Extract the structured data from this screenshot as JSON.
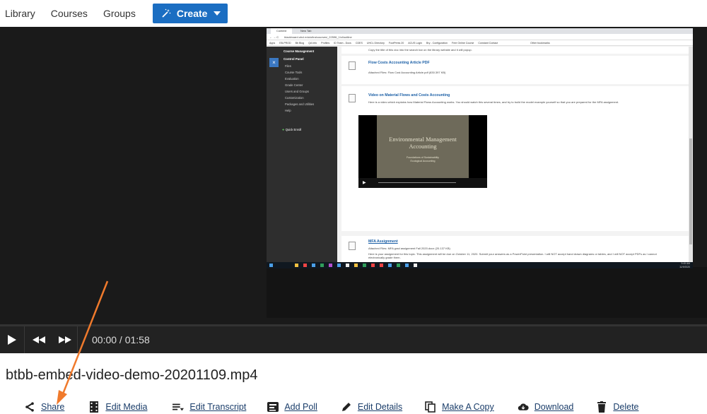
{
  "topnav": {
    "links": [
      "Library",
      "Courses",
      "Groups"
    ],
    "create_label": "Create"
  },
  "recording": {
    "tabs": [
      "Content",
      "New Tab"
    ],
    "address": "blackboard.uhcl.edu/ultra/courses/_22596_1/cl/outline",
    "bookmarks": [
      "Apps",
      "EB-PROD",
      "Bb Blog",
      "QA Info",
      "Profiles",
      "ID Team - Docs",
      "CDES",
      "UHCL Directory",
      "FootPrints 20",
      "ACUS Login",
      "Bry - Configuration",
      "Free Online Course",
      "Constant Contact",
      "Other bookmarks"
    ],
    "control_panel": {
      "course_management": "Course Management",
      "title": "Control Panel",
      "items": [
        "Files",
        "Course Tools",
        "Evaluation",
        "Grade Center",
        "Users and Groups",
        "Customization",
        "Packages and Utilities",
        "Help"
      ],
      "quick_enroll": "Quick Enroll"
    },
    "top_text": "Copy the title of this doc into the search bar on the library website and it will popup.",
    "item1_title": "Flow Costs Accounting Article PDF",
    "item1_attached": "Attached Files:  Flow Cost Accounting Article.pdf  (830.397 KB)",
    "item2_title": "Video on Material Flows and Costs Accounting",
    "item2_text": "Here is a video which explains how Material Flows Accounting works. You should watch this several times, and try to build the model example yourself so that you are prepared for the MFA assignment.",
    "slide_title": "Environmental Management Accounting",
    "slide_sub": "Foundations of Sustainability\nEcological Accounting",
    "item3_title": "MFA Assignment",
    "item3_attached": "Attached Files:  MFA grad assignment Fall 2020.docx  (20.137 KB)",
    "item3_text": "Here is your assignment for this topic. This assignment will be due on October 11, 2020. Submit your answers as a PowerPoint presentation. I will NOT accept hand drawn diagrams or tables, and I will NOT accept PDFs as I cannot electronically grade them.",
    "clock_time": "9:45 AM",
    "clock_date": "11/9/2020"
  },
  "player": {
    "timecode": "00:00 / 01:58"
  },
  "media_title": "btbb-embed-video-demo-20201109.mp4",
  "actions": [
    {
      "label": "Share",
      "icon": "share-icon"
    },
    {
      "label": "Edit Media",
      "icon": "film-icon"
    },
    {
      "label": "Edit Transcript",
      "icon": "transcript-icon"
    },
    {
      "label": "Add Poll",
      "icon": "poll-icon"
    },
    {
      "label": "Edit Details",
      "icon": "pencil-icon"
    },
    {
      "label": "Make A Copy",
      "icon": "copy-icon"
    },
    {
      "label": "Download",
      "icon": "cloud-download-icon"
    },
    {
      "label": "Delete",
      "icon": "trash-icon"
    }
  ],
  "colors": {
    "create_button": "#1b6ec2",
    "player_bg": "#1a1a1a",
    "link_text": "#1a3d6a",
    "annotation_arrow": "#f07a2c"
  }
}
